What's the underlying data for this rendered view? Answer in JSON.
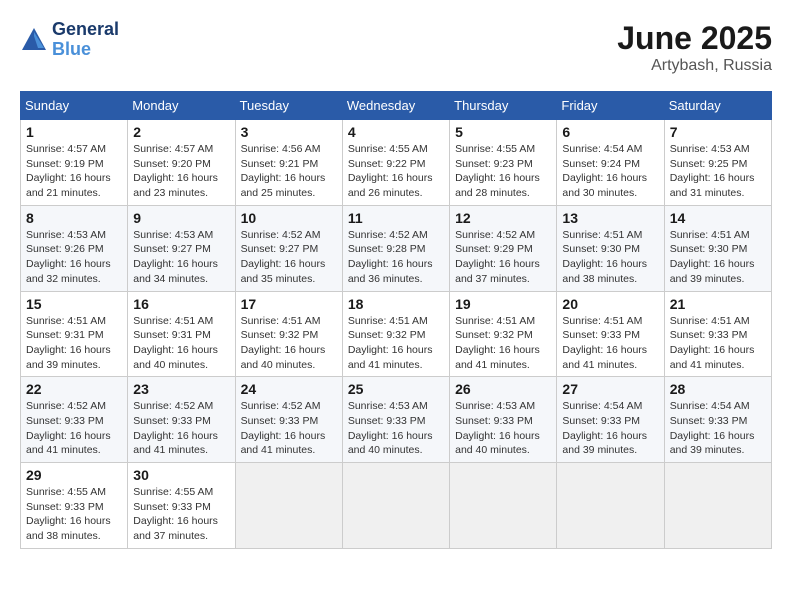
{
  "header": {
    "logo_line1": "General",
    "logo_line2": "Blue",
    "month": "June 2025",
    "location": "Artybash, Russia"
  },
  "days_of_week": [
    "Sunday",
    "Monday",
    "Tuesday",
    "Wednesday",
    "Thursday",
    "Friday",
    "Saturday"
  ],
  "weeks": [
    [
      {
        "day": 1,
        "sunrise": "Sunrise: 4:57 AM",
        "sunset": "Sunset: 9:19 PM",
        "daylight": "Daylight: 16 hours and 21 minutes."
      },
      {
        "day": 2,
        "sunrise": "Sunrise: 4:57 AM",
        "sunset": "Sunset: 9:20 PM",
        "daylight": "Daylight: 16 hours and 23 minutes."
      },
      {
        "day": 3,
        "sunrise": "Sunrise: 4:56 AM",
        "sunset": "Sunset: 9:21 PM",
        "daylight": "Daylight: 16 hours and 25 minutes."
      },
      {
        "day": 4,
        "sunrise": "Sunrise: 4:55 AM",
        "sunset": "Sunset: 9:22 PM",
        "daylight": "Daylight: 16 hours and 26 minutes."
      },
      {
        "day": 5,
        "sunrise": "Sunrise: 4:55 AM",
        "sunset": "Sunset: 9:23 PM",
        "daylight": "Daylight: 16 hours and 28 minutes."
      },
      {
        "day": 6,
        "sunrise": "Sunrise: 4:54 AM",
        "sunset": "Sunset: 9:24 PM",
        "daylight": "Daylight: 16 hours and 30 minutes."
      },
      {
        "day": 7,
        "sunrise": "Sunrise: 4:53 AM",
        "sunset": "Sunset: 9:25 PM",
        "daylight": "Daylight: 16 hours and 31 minutes."
      }
    ],
    [
      {
        "day": 8,
        "sunrise": "Sunrise: 4:53 AM",
        "sunset": "Sunset: 9:26 PM",
        "daylight": "Daylight: 16 hours and 32 minutes."
      },
      {
        "day": 9,
        "sunrise": "Sunrise: 4:53 AM",
        "sunset": "Sunset: 9:27 PM",
        "daylight": "Daylight: 16 hours and 34 minutes."
      },
      {
        "day": 10,
        "sunrise": "Sunrise: 4:52 AM",
        "sunset": "Sunset: 9:27 PM",
        "daylight": "Daylight: 16 hours and 35 minutes."
      },
      {
        "day": 11,
        "sunrise": "Sunrise: 4:52 AM",
        "sunset": "Sunset: 9:28 PM",
        "daylight": "Daylight: 16 hours and 36 minutes."
      },
      {
        "day": 12,
        "sunrise": "Sunrise: 4:52 AM",
        "sunset": "Sunset: 9:29 PM",
        "daylight": "Daylight: 16 hours and 37 minutes."
      },
      {
        "day": 13,
        "sunrise": "Sunrise: 4:51 AM",
        "sunset": "Sunset: 9:30 PM",
        "daylight": "Daylight: 16 hours and 38 minutes."
      },
      {
        "day": 14,
        "sunrise": "Sunrise: 4:51 AM",
        "sunset": "Sunset: 9:30 PM",
        "daylight": "Daylight: 16 hours and 39 minutes."
      }
    ],
    [
      {
        "day": 15,
        "sunrise": "Sunrise: 4:51 AM",
        "sunset": "Sunset: 9:31 PM",
        "daylight": "Daylight: 16 hours and 39 minutes."
      },
      {
        "day": 16,
        "sunrise": "Sunrise: 4:51 AM",
        "sunset": "Sunset: 9:31 PM",
        "daylight": "Daylight: 16 hours and 40 minutes."
      },
      {
        "day": 17,
        "sunrise": "Sunrise: 4:51 AM",
        "sunset": "Sunset: 9:32 PM",
        "daylight": "Daylight: 16 hours and 40 minutes."
      },
      {
        "day": 18,
        "sunrise": "Sunrise: 4:51 AM",
        "sunset": "Sunset: 9:32 PM",
        "daylight": "Daylight: 16 hours and 41 minutes."
      },
      {
        "day": 19,
        "sunrise": "Sunrise: 4:51 AM",
        "sunset": "Sunset: 9:32 PM",
        "daylight": "Daylight: 16 hours and 41 minutes."
      },
      {
        "day": 20,
        "sunrise": "Sunrise: 4:51 AM",
        "sunset": "Sunset: 9:33 PM",
        "daylight": "Daylight: 16 hours and 41 minutes."
      },
      {
        "day": 21,
        "sunrise": "Sunrise: 4:51 AM",
        "sunset": "Sunset: 9:33 PM",
        "daylight": "Daylight: 16 hours and 41 minutes."
      }
    ],
    [
      {
        "day": 22,
        "sunrise": "Sunrise: 4:52 AM",
        "sunset": "Sunset: 9:33 PM",
        "daylight": "Daylight: 16 hours and 41 minutes."
      },
      {
        "day": 23,
        "sunrise": "Sunrise: 4:52 AM",
        "sunset": "Sunset: 9:33 PM",
        "daylight": "Daylight: 16 hours and 41 minutes."
      },
      {
        "day": 24,
        "sunrise": "Sunrise: 4:52 AM",
        "sunset": "Sunset: 9:33 PM",
        "daylight": "Daylight: 16 hours and 41 minutes."
      },
      {
        "day": 25,
        "sunrise": "Sunrise: 4:53 AM",
        "sunset": "Sunset: 9:33 PM",
        "daylight": "Daylight: 16 hours and 40 minutes."
      },
      {
        "day": 26,
        "sunrise": "Sunrise: 4:53 AM",
        "sunset": "Sunset: 9:33 PM",
        "daylight": "Daylight: 16 hours and 40 minutes."
      },
      {
        "day": 27,
        "sunrise": "Sunrise: 4:54 AM",
        "sunset": "Sunset: 9:33 PM",
        "daylight": "Daylight: 16 hours and 39 minutes."
      },
      {
        "day": 28,
        "sunrise": "Sunrise: 4:54 AM",
        "sunset": "Sunset: 9:33 PM",
        "daylight": "Daylight: 16 hours and 39 minutes."
      }
    ],
    [
      {
        "day": 29,
        "sunrise": "Sunrise: 4:55 AM",
        "sunset": "Sunset: 9:33 PM",
        "daylight": "Daylight: 16 hours and 38 minutes."
      },
      {
        "day": 30,
        "sunrise": "Sunrise: 4:55 AM",
        "sunset": "Sunset: 9:33 PM",
        "daylight": "Daylight: 16 hours and 37 minutes."
      },
      null,
      null,
      null,
      null,
      null
    ]
  ]
}
